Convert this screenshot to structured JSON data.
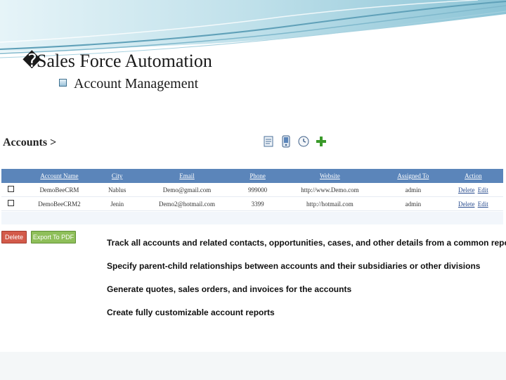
{
  "slide": {
    "title_glyph": "�",
    "title": "Sales Force Automation",
    "subtitle": "Account Management",
    "colors": {
      "swoosh_dark": "#5fa0b8",
      "swoosh_light": "#bfe0ea",
      "table_header": "#5b85ba"
    }
  },
  "screen": {
    "header": "Accounts >",
    "toolbar_icons": [
      "document-icon",
      "mobile-icon",
      "clock-icon",
      "add-icon"
    ],
    "table": {
      "columns": [
        "Account Name",
        "City",
        "Email",
        "Phone",
        "Website",
        "Assigned To",
        "Action"
      ],
      "rows": [
        {
          "name": "DemoBeeCRM",
          "city": "Nablus",
          "email": "Demo@gmail.com",
          "phone": "999000",
          "website": "http://www.Demo.com",
          "assigned": "admin",
          "delete": "Delete",
          "edit": "Edit"
        },
        {
          "name": "DemoBeeCRM2",
          "city": "Jenin",
          "email": "Demo2@hotmail.com",
          "phone": "3399",
          "website": "http://hotmail.com",
          "assigned": "admin",
          "delete": "Delete",
          "edit": "Edit"
        }
      ]
    },
    "buttons": {
      "delete": "Delete",
      "export_pdf": "Export To PDF"
    }
  },
  "features": [
    "Track all accounts and related contacts, opportunities, cases, and other details from a common repository•",
    "Specify parent-child relationships between accounts and their subsidiaries or other divisions",
    "Generate quotes, sales orders, and invoices for the accounts",
    "Create fully customizable account reports"
  ]
}
